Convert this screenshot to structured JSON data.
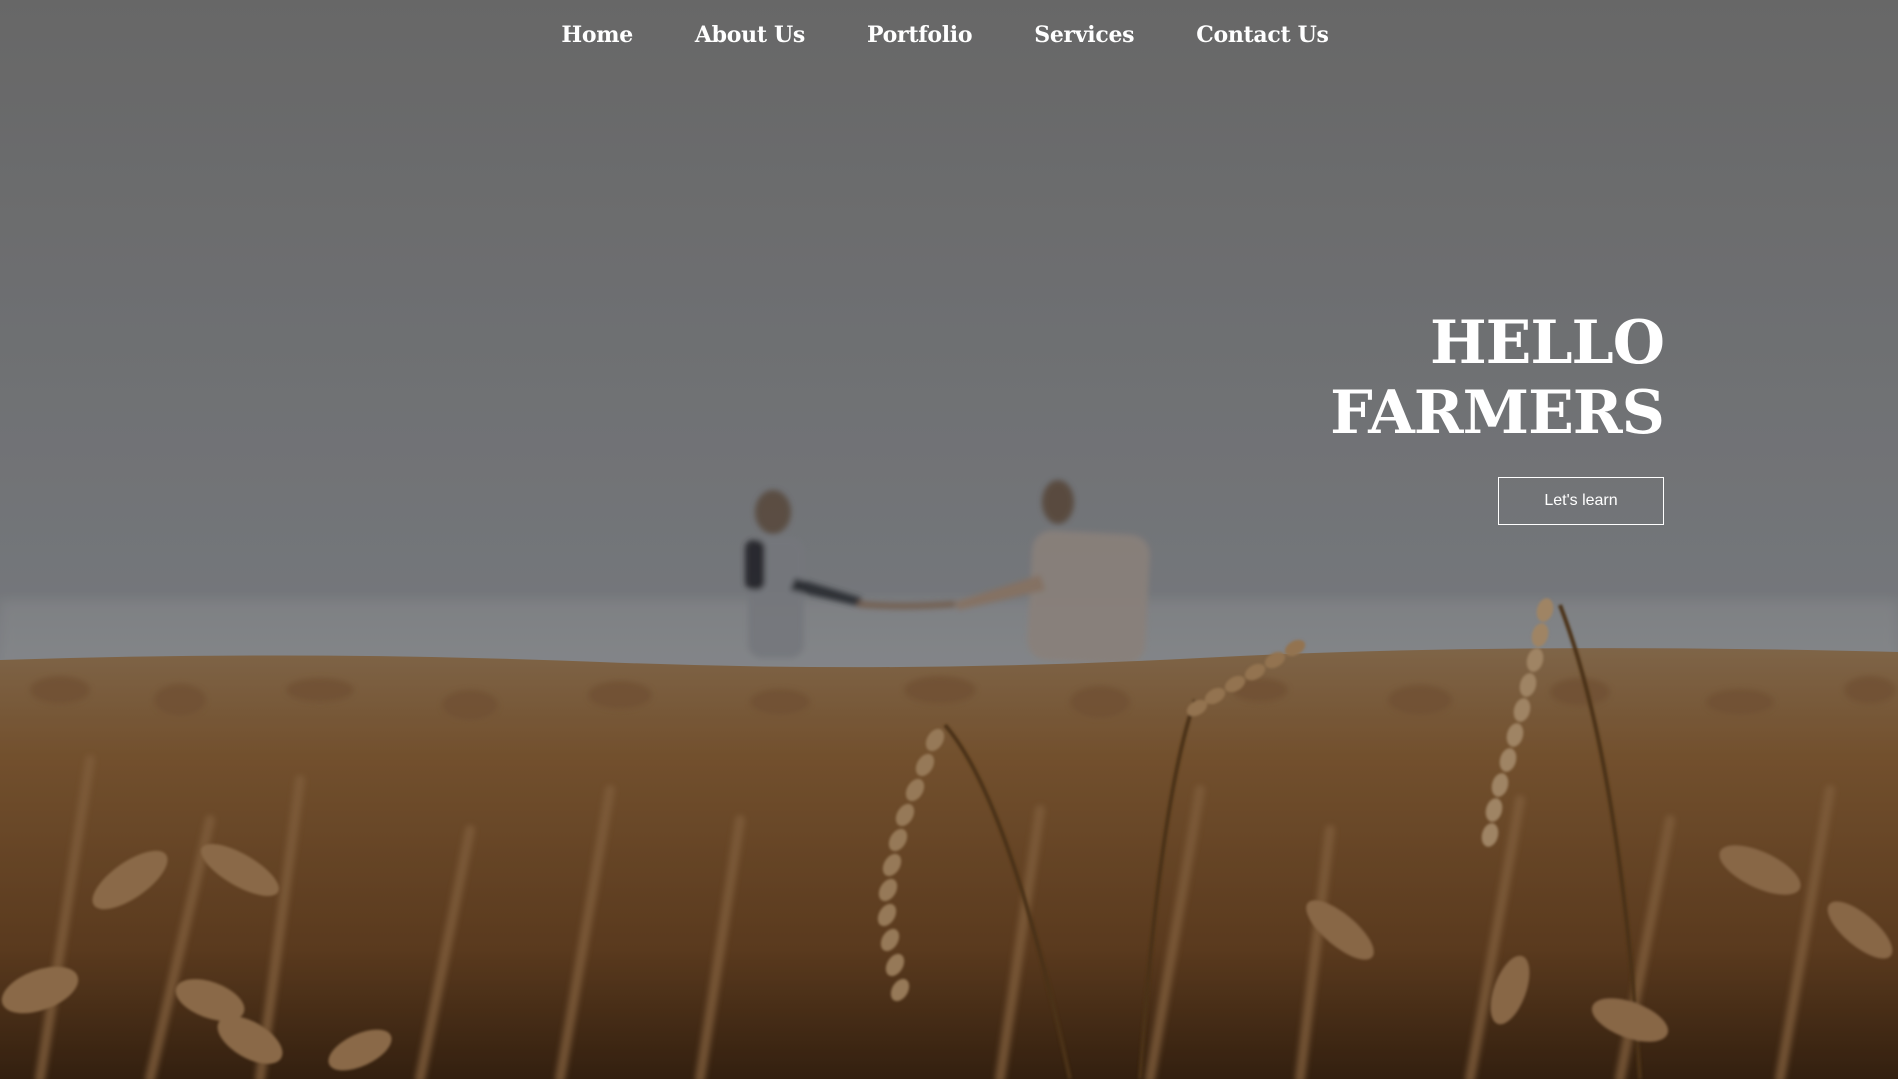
{
  "nav": {
    "items": [
      {
        "label": "Home"
      },
      {
        "label": "About Us"
      },
      {
        "label": "Portfolio"
      },
      {
        "label": "Services"
      },
      {
        "label": "Contact Us"
      }
    ]
  },
  "hero": {
    "title_line_1": "HELLO",
    "title_line_2": "FARMERS",
    "cta_label": "Let's learn",
    "image_subject": "two people shaking hands in a wheat field"
  },
  "colors": {
    "text": "#ffffff",
    "sky": "#8a8d92",
    "wheat": "#9a6b3b"
  }
}
